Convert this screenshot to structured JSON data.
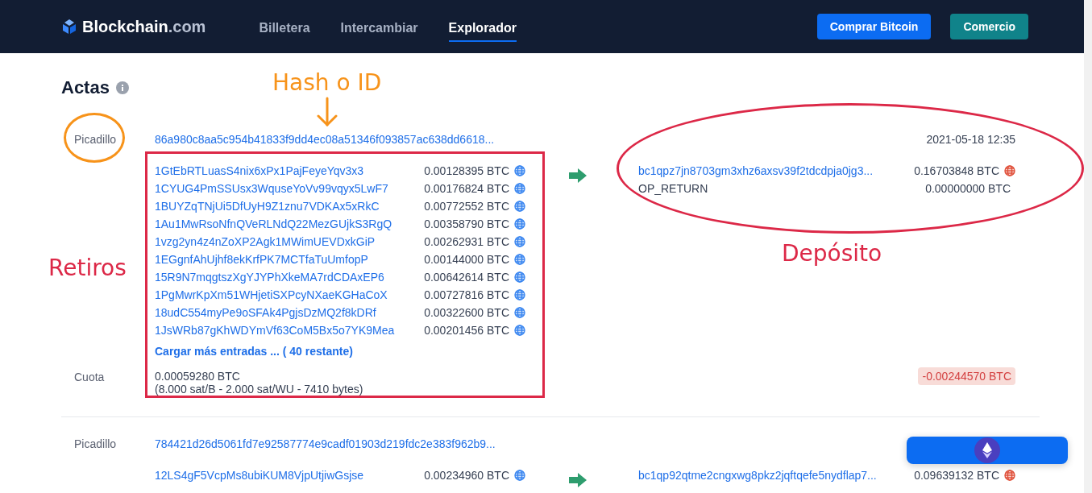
{
  "header": {
    "logo": {
      "name": "Blockchain",
      "suffix": ".com"
    },
    "nav": [
      {
        "label": "Billetera",
        "selected": false
      },
      {
        "label": "Intercambiar",
        "selected": false
      },
      {
        "label": "Explorador",
        "selected": true
      }
    ],
    "buttons": [
      {
        "label": "Comprar Bitcoin",
        "kind": "primary"
      },
      {
        "label": "Comercio",
        "kind": "secondary"
      }
    ]
  },
  "page": {
    "title": "Actas"
  },
  "transactions": [
    {
      "hash_label": "Picadillo",
      "hash": "86a980c8aa5c954b41833f9dd4ec08a51346f093857ac638dd6618...",
      "time": "2021-05-18 12:35",
      "inputs": [
        {
          "address": "1GtEbRTLuasS4nix6xPx1PajFeyeYqv3x3",
          "amount": "0.00128395 BTC"
        },
        {
          "address": "1CYUG4PmSSUsx3WquseYoVv99vqyx5LwF7",
          "amount": "0.00176824 BTC"
        },
        {
          "address": "1BUYZqTNjUi5DfUyH9Z1znu7VDKAx5xRkC",
          "amount": "0.00772552 BTC"
        },
        {
          "address": "1Au1MwRsoNfnQVeRLNdQ22MezGUjkS3RgQ",
          "amount": "0.00358790 BTC"
        },
        {
          "address": "1vzg2yn4z4nZoXP2Agk1MWimUEVDxkGiP",
          "amount": "0.00262931 BTC"
        },
        {
          "address": "1EGgnfAhUjhf8ekKrfPK7MCTfaTuUmfopP",
          "amount": "0.00144000 BTC"
        },
        {
          "address": "15R9N7mqgtszXgYJYPhXkeMA7rdCDAxEP6",
          "amount": "0.00642614 BTC"
        },
        {
          "address": "1PgMwrKpXm51WHjetiSXPcyNXaeKGHaCoX",
          "amount": "0.00727816 BTC"
        },
        {
          "address": "18udC554myPe9oSFAk4PgjsDzMQ2f8kDRf",
          "amount": "0.00322600 BTC"
        },
        {
          "address": "1JsWRb87gKhWDYmVf63CoM5Bx5o7YK9Mea",
          "amount": "0.00201456 BTC"
        }
      ],
      "load_more": "Cargar más entradas ... ( 40 restante)",
      "outputs": [
        {
          "kind": "address",
          "address": "bc1qpz7jn8703gm3xhz6axsv39f2tdcdpja0jg3...",
          "amount": "0.16703848 BTC",
          "spent": true
        },
        {
          "kind": "data",
          "address": "OP_RETURN",
          "amount": "0.00000000 BTC"
        }
      ],
      "fee_label": "Cuota",
      "fee": "0.00059280 BTC",
      "fee_detail": "(8.000 sat/B - 2.000 sat/WU - 7410 bytes)",
      "total": "-0.00244570 BTC"
    },
    {
      "hash_label": "Picadillo",
      "hash": "784421d26d5061fd7e92587774e9cadf01903d219fdc2e383f962b9...",
      "inputs": [
        {
          "address": "12LS4gF5VcpMs8ubiKUM8VjpUtjiwGsjse",
          "amount": "0.00234960 BTC"
        }
      ],
      "outputs": [
        {
          "kind": "address",
          "address": "bc1qp92qtme2cngxwg8pkz2jqftqefe5nydflap7...",
          "amount": "0.09639132 BTC",
          "spent": true
        }
      ]
    }
  ],
  "annotations": [
    {
      "kind": "label",
      "text": "Hash o ID",
      "color": "#f7931a"
    },
    {
      "kind": "arrow",
      "color": "#f7931a"
    },
    {
      "kind": "ellipse",
      "color": "#f7931a"
    },
    {
      "kind": "rect",
      "color": "#dc2847"
    },
    {
      "kind": "label",
      "text": "Retiros",
      "color": "#dc2847"
    },
    {
      "kind": "ellipse",
      "color": "#dc2847"
    },
    {
      "kind": "label",
      "text": "Depósito",
      "color": "#dc2847"
    }
  ]
}
